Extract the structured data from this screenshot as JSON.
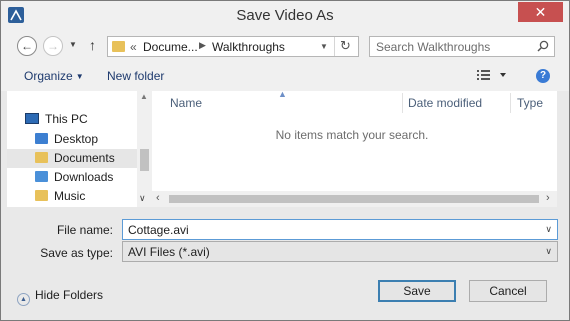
{
  "window": {
    "title": "Save Video As",
    "close_glyph": "✕"
  },
  "address": {
    "overflow": "«",
    "crumbs": [
      "Docume...",
      "Walkthroughs"
    ],
    "separator": "▶",
    "search_placeholder": "Search Walkthroughs"
  },
  "toolbar": {
    "organize": "Organize",
    "new_folder": "New folder",
    "help": "?"
  },
  "nav": {
    "items": [
      {
        "label": "This PC",
        "icon": "pc-icon"
      },
      {
        "label": "Desktop",
        "icon": "folder-icon"
      },
      {
        "label": "Documents",
        "icon": "folder-icon",
        "selected": true
      },
      {
        "label": "Downloads",
        "icon": "folder-icon"
      },
      {
        "label": "Music",
        "icon": "folder-icon"
      }
    ]
  },
  "files": {
    "columns": [
      "Name",
      "Date modified",
      "Type"
    ],
    "empty_message": "No items match your search."
  },
  "fields": {
    "file_name_label": "File name:",
    "file_name_value": "Cottage.avi",
    "save_type_label": "Save as type:",
    "save_type_value": "AVI Files (*.avi)"
  },
  "footer": {
    "hide_folders": "Hide Folders",
    "save": "Save",
    "cancel": "Cancel"
  },
  "colors": {
    "close_button": "#c75050",
    "link_text": "#1e3a6e",
    "default_button_border": "#3c7fb1"
  }
}
